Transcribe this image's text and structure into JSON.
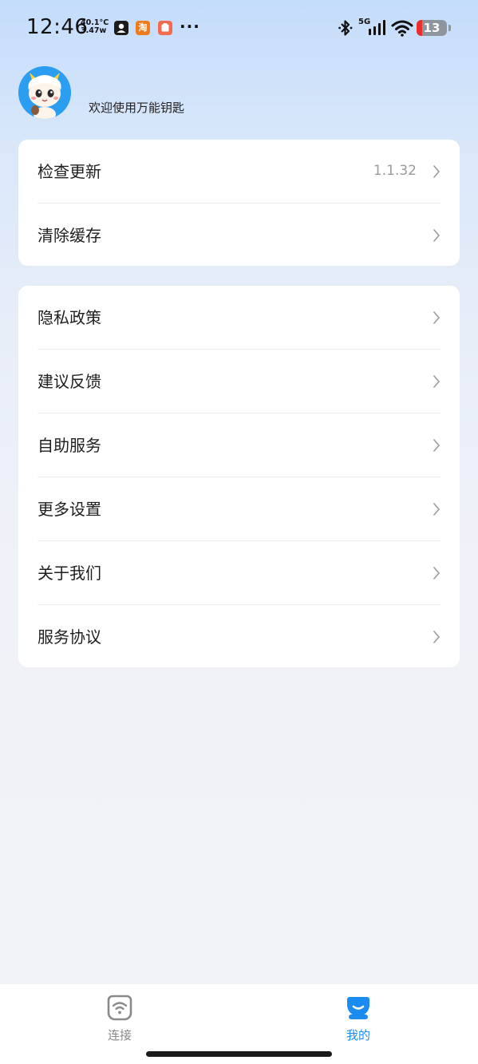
{
  "status_bar": {
    "time": "12:46",
    "temperature": "40.1°C",
    "power": "3.47w",
    "taobao_label": "淘",
    "more": "···",
    "network": "5G",
    "battery": "13"
  },
  "profile": {
    "welcome_text": "欢迎使用万能钥匙"
  },
  "group1": {
    "items": [
      {
        "label": "检查更新",
        "value": "1.1.32",
        "icon": "chevron-right-icon"
      },
      {
        "label": "清除缓存",
        "icon": "chevron-right-icon"
      }
    ]
  },
  "group2": {
    "items": [
      {
        "label": "隐私政策",
        "icon": "chevron-right-icon"
      },
      {
        "label": "建议反馈",
        "icon": "chevron-right-icon"
      },
      {
        "label": "自助服务",
        "icon": "chevron-right-icon"
      },
      {
        "label": "更多设置",
        "icon": "chevron-right-icon"
      },
      {
        "label": "关于我们",
        "icon": "chevron-right-icon"
      },
      {
        "label": "服务协议",
        "icon": "chevron-right-icon"
      }
    ]
  },
  "bottom_nav": {
    "tabs": [
      {
        "label": "连接",
        "icon": "wifi-connect-icon",
        "active": false
      },
      {
        "label": "我的",
        "icon": "profile-icon",
        "active": true
      }
    ]
  },
  "colors": {
    "accent": "#1a8cf0",
    "inactive": "#8a8a8a"
  }
}
